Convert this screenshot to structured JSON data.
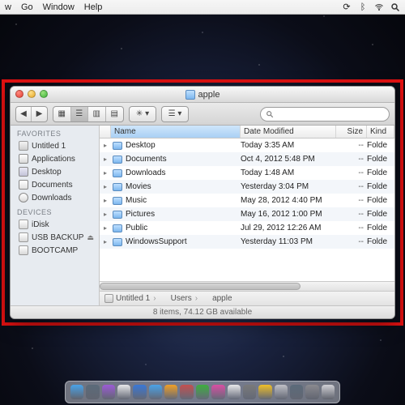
{
  "menubar": {
    "items": [
      "w",
      "Go",
      "Window",
      "Help"
    ],
    "right_icons": [
      "sync-icon",
      "bluetooth-icon",
      "wifi-icon",
      "spotlight-icon"
    ]
  },
  "finder": {
    "title": "apple",
    "toolbar": {
      "view_modes": [
        "icon",
        "list",
        "column",
        "coverflow"
      ],
      "active_view": 1
    },
    "search": {
      "placeholder": ""
    },
    "sidebar": {
      "sections": [
        {
          "header": "FAVORITES",
          "items": [
            {
              "icon": "hd",
              "label": "Untitled 1"
            },
            {
              "icon": "app",
              "label": "Applications"
            },
            {
              "icon": "desktop",
              "label": "Desktop"
            },
            {
              "icon": "doc",
              "label": "Documents"
            },
            {
              "icon": "dl",
              "label": "Downloads"
            }
          ]
        },
        {
          "header": "DEVICES",
          "items": [
            {
              "icon": "disk",
              "label": "iDisk"
            },
            {
              "icon": "disk",
              "label": "USB BACKUP",
              "eject": true
            },
            {
              "icon": "disk",
              "label": "BOOTCAMP"
            }
          ]
        }
      ]
    },
    "columns": {
      "name": "Name",
      "date": "Date Modified",
      "size": "Size",
      "kind": "Kind"
    },
    "rows": [
      {
        "name": "Desktop",
        "date": "Today 3:35 AM",
        "size": "--",
        "kind": "Folde"
      },
      {
        "name": "Documents",
        "date": "Oct 4, 2012 5:48 PM",
        "size": "--",
        "kind": "Folde"
      },
      {
        "name": "Downloads",
        "date": "Today 1:48 AM",
        "size": "--",
        "kind": "Folde"
      },
      {
        "name": "Movies",
        "date": "Yesterday 3:04 PM",
        "size": "--",
        "kind": "Folde"
      },
      {
        "name": "Music",
        "date": "May 28, 2012 4:40 PM",
        "size": "--",
        "kind": "Folde"
      },
      {
        "name": "Pictures",
        "date": "May 16, 2012 1:00 PM",
        "size": "--",
        "kind": "Folde"
      },
      {
        "name": "Public",
        "date": "Jul 29, 2012 12:26 AM",
        "size": "--",
        "kind": "Folde"
      },
      {
        "name": "WindowsSupport",
        "date": "Yesterday 11:03 PM",
        "size": "--",
        "kind": "Folde"
      }
    ],
    "path": [
      {
        "icon": "hd",
        "label": "Untitled 1"
      },
      {
        "icon": "folder",
        "label": "Users"
      },
      {
        "icon": "folder",
        "label": "apple"
      }
    ],
    "status": "8 items, 74.12 GB available"
  },
  "dock": {
    "apps": [
      "#4aa3e8",
      "#5b6b7a",
      "#9c5bd6",
      "#e8e8ea",
      "#3a78d6",
      "#4aa3e8",
      "#f0a028",
      "#c35050",
      "#3fae3f",
      "#d94fa3",
      "#e8e8ea",
      "#7a7a7a",
      "#f0c028",
      "#c0c0c6",
      "#5b6b7a",
      "#8a8a8f",
      "#d0d0d5"
    ]
  }
}
